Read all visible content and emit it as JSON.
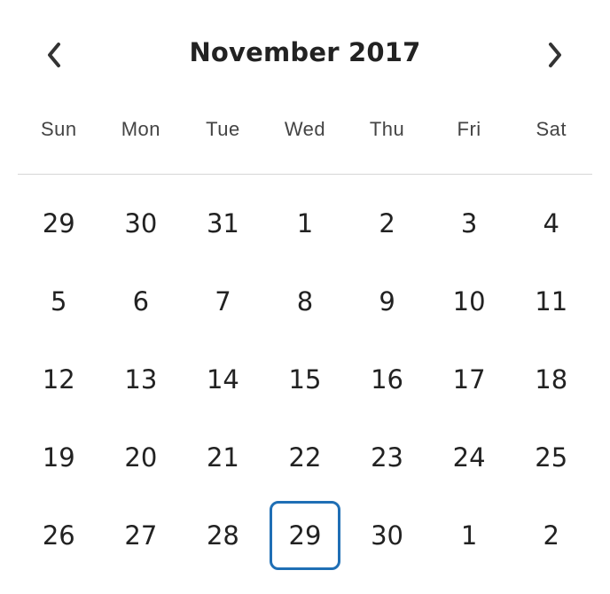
{
  "calendar": {
    "month_label": "November 2017",
    "prev_icon": "chevron-left-icon",
    "next_icon": "chevron-right-icon",
    "accent_color": "#1f6fb5",
    "weekdays": [
      "Sun",
      "Mon",
      "Tue",
      "Wed",
      "Thu",
      "Fri",
      "Sat"
    ],
    "weeks": [
      [
        "29",
        "30",
        "31",
        "1",
        "2",
        "3",
        "4"
      ],
      [
        "5",
        "6",
        "7",
        "8",
        "9",
        "10",
        "11"
      ],
      [
        "12",
        "13",
        "14",
        "15",
        "16",
        "17",
        "18"
      ],
      [
        "19",
        "20",
        "21",
        "22",
        "23",
        "24",
        "25"
      ],
      [
        "26",
        "27",
        "28",
        "29",
        "30",
        "1",
        "2"
      ]
    ],
    "selected": {
      "week": 4,
      "day": 3
    }
  }
}
